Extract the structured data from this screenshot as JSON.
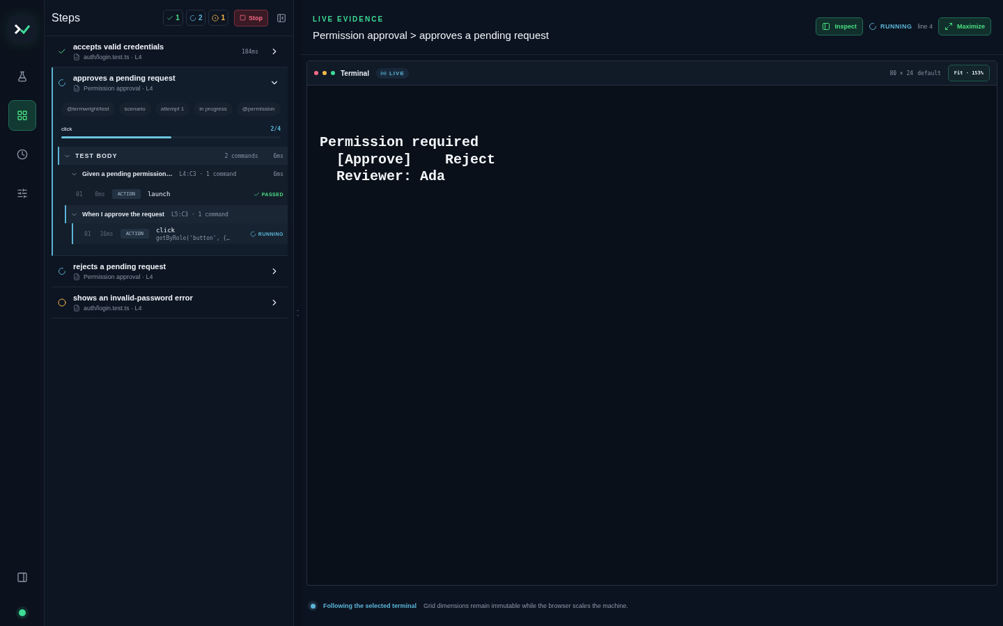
{
  "rail": {
    "items": [
      {
        "kind": "flask",
        "selected": false
      },
      {
        "kind": "grid",
        "selected": true
      },
      {
        "kind": "clock",
        "selected": false
      },
      {
        "kind": "sliders",
        "selected": false
      }
    ],
    "online": true
  },
  "steps": {
    "title": "Steps",
    "counters": [
      {
        "kind": "passed",
        "count": "1"
      },
      {
        "kind": "running",
        "count": "2"
      },
      {
        "kind": "pending",
        "count": "1"
      }
    ],
    "stop": "Stop",
    "tests": [
      {
        "kind": "passed",
        "title": "accepts valid credentials",
        "file": "auth/login.test.ts · L4",
        "duration": "184ms",
        "expanded": false,
        "selected": false
      },
      {
        "kind": "running",
        "title": "approves a pending request",
        "file": "Permission approval · L4",
        "expanded": true,
        "selected": true,
        "tags": [
          "@termwright/test",
          "scenario",
          "attempt 1",
          "in progress",
          "@permission"
        ],
        "progress": {
          "label": "click",
          "count": "2/4",
          "level": 0.5
        },
        "body": {
          "title": "TEST BODY",
          "commands": "2 commands",
          "duration": "6ms",
          "expanded": true,
          "groups": [
            {
              "title": "Given a pending permission…",
              "meta": "L4:C3 · 1 command",
              "duration": "6ms",
              "expanded": true,
              "active": false,
              "items": [
                {
                  "index": "01",
                  "duration": "8ms",
                  "type": "ACTION",
                  "name": "launch",
                  "kind": "passed",
                  "status_label": "PASSED"
                }
              ]
            },
            {
              "title": "When I approve the request",
              "meta": "L5:C3 · 1 command",
              "expanded": true,
              "active": true,
              "items": [
                {
                  "index": "01",
                  "duration": "16ms",
                  "type": "ACTION",
                  "name": "click",
                  "detail": "getByRole('button', {…",
                  "kind": "running",
                  "status_label": "RUNNING"
                }
              ]
            }
          ]
        }
      },
      {
        "kind": "running",
        "title": "rejects a pending request",
        "file": "Permission approval · L4",
        "expanded": false,
        "selected": false
      },
      {
        "kind": "pending",
        "title": "shows an invalid-password error",
        "file": "auth/login.test.ts · L4",
        "expanded": false,
        "selected": false
      }
    ]
  },
  "evidence": {
    "eyebrow": "LIVE EVIDENCE",
    "breadcrumb": "Permission approval > approves a pending request",
    "inspect": "Inspect",
    "status": "RUNNING",
    "line": "line 4",
    "maximize": "Maximize",
    "terminal": {
      "title": "Terminal",
      "live": "LIVE",
      "size": "80 × 24",
      "theme": "default",
      "fit": "Fit · 153%",
      "lines": [
        "Permission required",
        "  [Approve]    Reject",
        "  Reviewer: Ada"
      ]
    },
    "footer": {
      "label": "Following the selected terminal",
      "note": "Grid dimensions remain immutable while the browser scales the machine."
    }
  }
}
